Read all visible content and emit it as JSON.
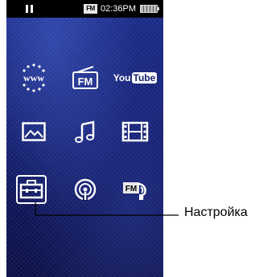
{
  "status_bar": {
    "time": "02:36PM",
    "fm_badge": "FM"
  },
  "menu": {
    "youtube_you": "You",
    "youtube_tube": "Tube",
    "items": [
      {
        "icon": "www-icon"
      },
      {
        "icon": "fm-radio-icon"
      },
      {
        "icon": "youtube-icon"
      },
      {
        "icon": "photo-icon"
      },
      {
        "icon": "music-icon"
      },
      {
        "icon": "video-icon"
      },
      {
        "icon": "settings-toolbox-icon",
        "selected": true
      },
      {
        "icon": "podcast-icon"
      },
      {
        "icon": "fm-recording-icon"
      }
    ]
  },
  "callout": {
    "label": "Настройка"
  },
  "colors": {
    "screen_bg": "#10185e",
    "status_bg": "#000000",
    "icon": "#ffffff",
    "callout_line": "#000000"
  }
}
